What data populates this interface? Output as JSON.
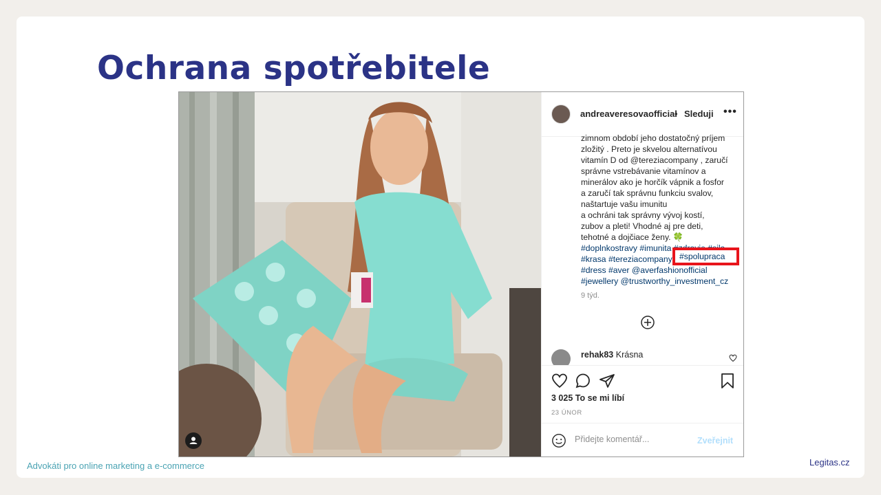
{
  "slide": {
    "title": "Ochrana spotřebitele",
    "footer_left": "Advokáti pro online marketing a e-commerce",
    "footer_right": "Legitas.cz"
  },
  "post": {
    "username": "andreaveresovaofficial",
    "follow_separator": "•",
    "follow_label": "Sleduji",
    "more_label": "•••",
    "caption_lines": [
      "zimnom období jeho dostatočný príjem",
      "zložitý . Preto je skvelou alternatívou",
      "vitamín D od @tereziacompany , zaručí",
      "správne vstrebávanie vitamínov a",
      "minerálov ako je horčík vápnik a fosfor",
      "a zaručí tak správnu funkciu svalov,",
      "naštartuje vašu imunitu",
      "a ochráni tak správny vývoj kostí,",
      "zubov a pleti! Vhodné aj pre deti,",
      "tehotné a dojčiace ženy. 🍀",
      "#doplnkostravy #imunita #zdravie #sila",
      "#krasa #tereziacompany",
      "#dress #aver @averfashionofficial",
      "#jewellery @trustworthy_investment_cz"
    ],
    "highlighted_tag": "#spolupraca",
    "age": "9 týd.",
    "comment": {
      "user": "rehak83",
      "text": "Krásna"
    },
    "likes": "3 025 To se mi líbí",
    "date": "23 ÚNOR",
    "comment_placeholder": "Přidejte komentář...",
    "post_button": "Zveřejnit"
  },
  "icons": [
    "user-tag-icon",
    "more-icon",
    "plus-circle-icon",
    "heart-icon",
    "comment-icon",
    "share-icon",
    "bookmark-icon",
    "emoji-icon"
  ],
  "colors": {
    "title": "#2b3386",
    "footer_left": "#4aa3b3",
    "highlight_box": "#e8141b",
    "hashtag": "#00376b",
    "post_button": "#b2dffc"
  }
}
